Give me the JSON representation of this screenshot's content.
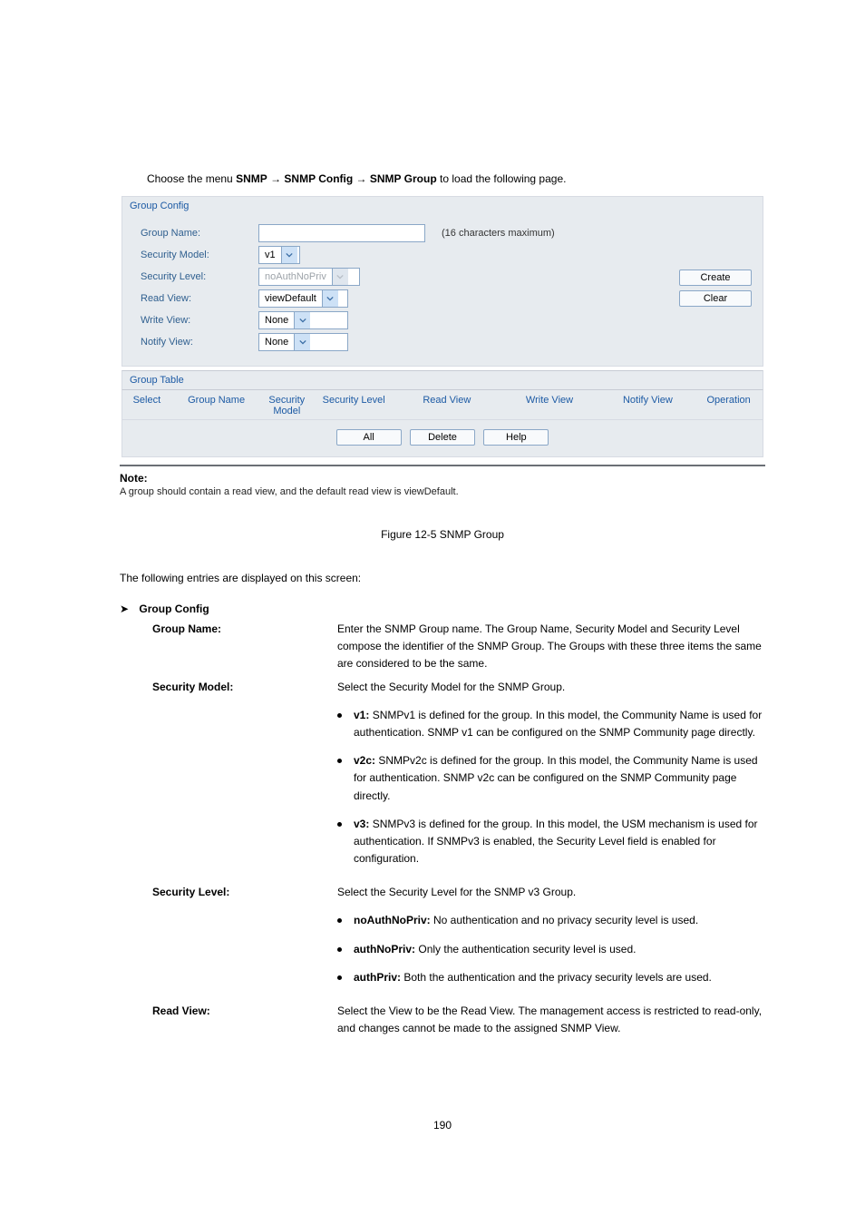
{
  "breadcrumb": {
    "prefix": "Choose the menu ",
    "p1": "SNMP",
    "arrow": "→",
    "p2": "SNMP Config",
    "p3": "SNMP Group",
    "suffix": " to load the following page."
  },
  "panel": {
    "groupConfigTitle": "Group Config",
    "labels": {
      "groupName": "Group Name:",
      "securityModel": "Security Model:",
      "securityLevel": "Security Level:",
      "readView": "Read View:",
      "writeView": "Write View:",
      "notifyView": "Notify View:"
    },
    "hint": "(16 characters maximum)",
    "values": {
      "securityModel": "v1",
      "securityLevel": "noAuthNoPriv",
      "readView": "viewDefault",
      "writeView": "None",
      "notifyView": "None"
    },
    "buttons": {
      "create": "Create",
      "clear": "Clear",
      "all": "All",
      "delete": "Delete",
      "help": "Help"
    },
    "groupTableTitle": "Group Table",
    "headers": {
      "select": "Select",
      "groupName": "Group Name",
      "securityModel": "Security\nModel",
      "securityLevel": "Security Level",
      "readView": "Read View",
      "writeView": "Write View",
      "notifyView": "Notify View",
      "operation": "Operation"
    }
  },
  "note": {
    "title": "Note:",
    "body": "A group should contain a read view, and the default read view is viewDefault."
  },
  "figCaption": "Figure 12-5 SNMP Group",
  "entriesIntro": "The following entries are displayed on this screen:",
  "sectionHeader": "Group Config",
  "defs": {
    "groupName": {
      "term": "Group Name:",
      "def": "Enter the SNMP Group name. The Group Name, Security Model and Security Level compose the identifier of the SNMP Group. The Groups with these three items the same are considered to be the same."
    },
    "securityModel": {
      "term": "Security Model:",
      "def": "Select the Security Model for the SNMP Group."
    },
    "securityLevel": {
      "term": "Security Level:",
      "def": "Select the Security Level for the SNMP v3 Group."
    },
    "sm": {
      "v1": {
        "label": "v1:",
        "text": "SNMPv1 is defined for the group. In this model, the Community Name is used for authentication. SNMP v1 can be configured on the SNMP Community page directly."
      },
      "v2c": {
        "label": "v2c:",
        "text": "SNMPv2c is defined for the group. In this model, the Community Name is used for authentication. SNMP v2c can be configured on the SNMP Community page directly."
      },
      "v3": {
        "label": "v3:",
        "text": "SNMPv3 is defined for the group. In this model, the USM mechanism is used for authentication. If SNMPv3 is enabled, the Security Level field is enabled for configuration."
      }
    },
    "sl": {
      "nn": {
        "label": "noAuthNoPriv:",
        "text": "No authentication and no privacy security level is used."
      },
      "an": {
        "label": "authNoPriv:",
        "text": "Only the authentication security level is used."
      },
      "ap": {
        "label": "authPriv:",
        "text": "Both the authentication and the privacy security levels are used."
      }
    },
    "readView": {
      "term": "Read View:",
      "def": "Select the View to be the Read View. The management access is restricted to read-only, and changes cannot be made to the assigned SNMP View."
    }
  },
  "pageNum": "190"
}
